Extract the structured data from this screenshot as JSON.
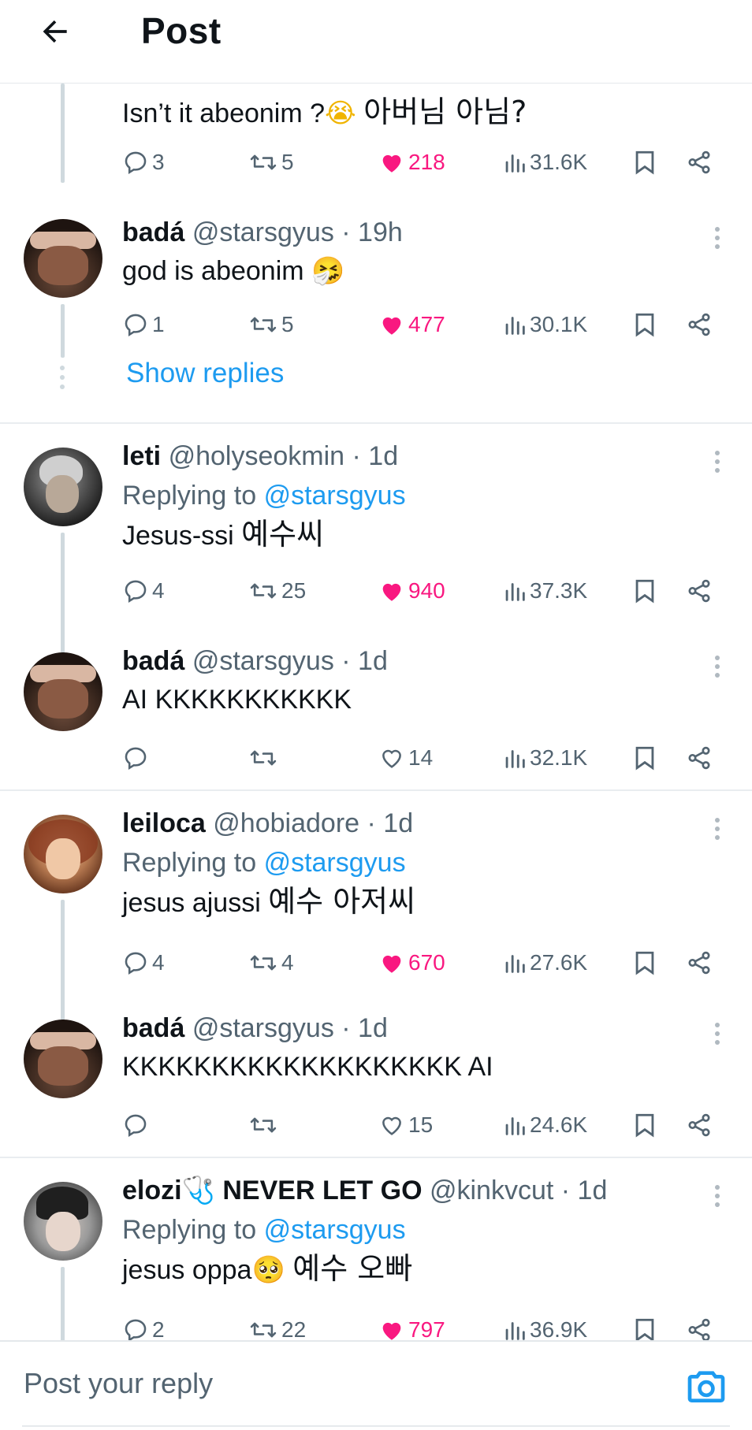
{
  "header": {
    "title": "Post",
    "back_icon": "arrow-left-icon"
  },
  "colors": {
    "accent": "#1d9bf0",
    "like": "#f91880",
    "muted": "#536471"
  },
  "top_tweet": {
    "text_en": "Isn’t it abeonim ?",
    "emoji": "😭",
    "text_kr": "아버님 아님?",
    "stats": {
      "replies": "3",
      "retweets": "5",
      "likes": "218",
      "views": "31.6K",
      "liked": true
    }
  },
  "tweets": [
    {
      "name": "badá",
      "handle": "@starsgyus",
      "time": "19h",
      "text": "god is abeonim",
      "emoji": "🤧",
      "stats": {
        "replies": "1",
        "retweets": "5",
        "likes": "477",
        "views": "30.1K",
        "liked": true
      }
    },
    {
      "name": "leti",
      "handle": "@holyseokmin",
      "time": "1d",
      "reply_label": "Replying to",
      "reply_mention": "@starsgyus",
      "text": "Jesus-ssi",
      "text_kr": "예수씨",
      "stats": {
        "replies": "4",
        "retweets": "25",
        "likes": "940",
        "views": "37.3K",
        "liked": true
      }
    },
    {
      "name": "badá",
      "handle": "@starsgyus",
      "time": "1d",
      "text": "AI KKKKKKKKKKK",
      "stats": {
        "replies": "",
        "retweets": "",
        "likes": "14",
        "views": "32.1K",
        "liked": false
      }
    },
    {
      "name": "leiloca",
      "handle": "@hobiadore",
      "time": "1d",
      "reply_label": "Replying to",
      "reply_mention": "@starsgyus",
      "text": "jesus ajussi",
      "text_kr": "예수 아저씨",
      "stats": {
        "replies": "4",
        "retweets": "4",
        "likes": "670",
        "views": "27.6K",
        "liked": true
      }
    },
    {
      "name": "badá",
      "handle": "@starsgyus",
      "time": "1d",
      "text": "KKKKKKKKKKKKKKKKKKK AI",
      "stats": {
        "replies": "",
        "retweets": "",
        "likes": "15",
        "views": "24.6K",
        "liked": false
      }
    },
    {
      "name": "elozi",
      "name_emoji": "🩺",
      "name_suffix": "NEVER LET GO",
      "handle": "@kinkvcut",
      "time": "1d",
      "reply_label": "Replying to",
      "reply_mention": "@starsgyus",
      "text": "jesus oppa",
      "emoji": "🥺",
      "text_kr": "예수 오빠",
      "stats": {
        "replies": "2",
        "retweets": "22",
        "likes": "797",
        "views": "36.9K",
        "liked": true
      }
    }
  ],
  "show_replies": "Show replies",
  "reply_bar": {
    "placeholder": "Post your reply",
    "camera_icon": "camera-icon"
  }
}
